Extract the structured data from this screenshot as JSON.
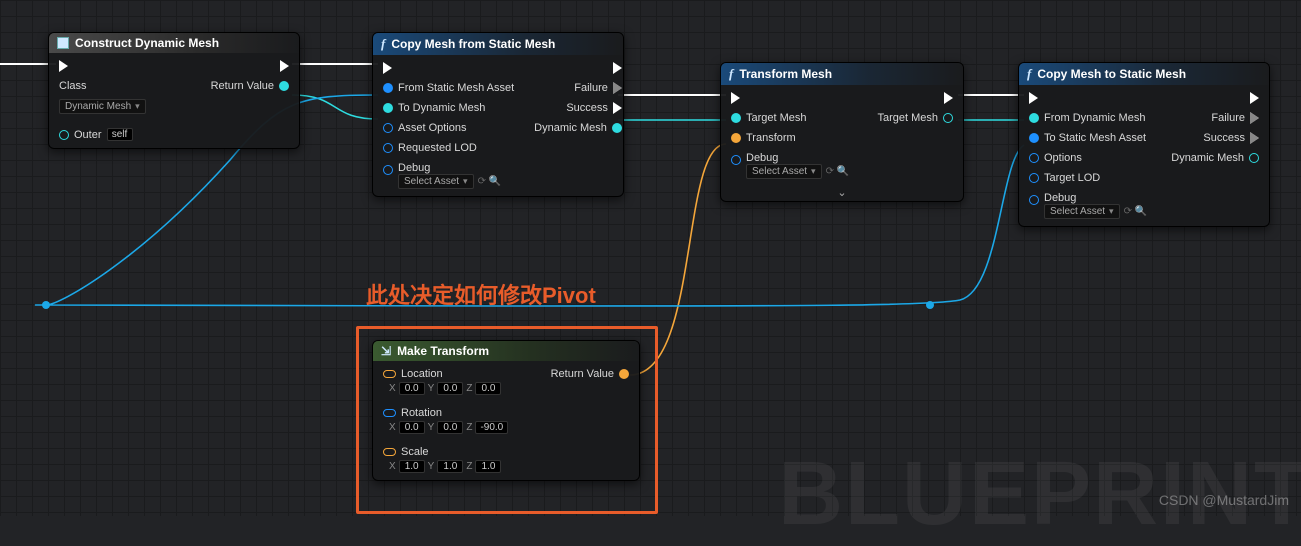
{
  "annotation": "此处决定如何修改Pivot",
  "watermark_bp": "BLUEPRINT",
  "watermark_csdn": "CSDN @MustardJim",
  "nodes": {
    "construct": {
      "title": "Construct Dynamic Mesh",
      "class_label": "Class",
      "class_value": "Dynamic Mesh",
      "outer_label": "Outer",
      "outer_value": "self",
      "return": "Return Value"
    },
    "copyFrom": {
      "title": "Copy Mesh from Static Mesh",
      "failure": "Failure",
      "success": "Success",
      "dynmesh": "Dynamic Mesh",
      "in1": "From Static Mesh Asset",
      "in2": "To Dynamic Mesh",
      "in3": "Asset Options",
      "in4": "Requested LOD",
      "debug": "Debug",
      "debug_value": "Select Asset"
    },
    "transform": {
      "title": "Transform Mesh",
      "targetmesh": "Target Mesh",
      "targetmesh_out": "Target Mesh",
      "transform_in": "Transform",
      "debug": "Debug",
      "debug_value": "Select Asset"
    },
    "copyTo": {
      "title": "Copy Mesh to Static Mesh",
      "failure": "Failure",
      "success": "Success",
      "dynmesh": "Dynamic Mesh",
      "in1": "From Dynamic Mesh",
      "in2": "To Static Mesh Asset",
      "in3": "Options",
      "in4": "Target LOD",
      "debug": "Debug",
      "debug_value": "Select Asset"
    },
    "make": {
      "title": "Make Transform",
      "return": "Return Value",
      "loc": "Location",
      "rot": "Rotation",
      "scale": "Scale",
      "loc_x": "0.0",
      "loc_y": "0.0",
      "loc_z": "0.0",
      "rot_x": "0.0",
      "rot_y": "0.0",
      "rot_z": "-90.0",
      "scl_x": "1.0",
      "scl_y": "1.0",
      "scl_z": "1.0"
    }
  },
  "chart_data": {
    "type": "table",
    "title": "Blueprint Graph",
    "nodes": [
      {
        "id": "construct",
        "label": "Construct Dynamic Mesh",
        "inputs": [
          "exec",
          "Class=Dynamic Mesh",
          "Outer=self"
        ],
        "outputs": [
          "exec",
          "Return Value"
        ]
      },
      {
        "id": "copyFrom",
        "label": "Copy Mesh from Static Mesh",
        "inputs": [
          "exec",
          "From Static Mesh Asset",
          "To Dynamic Mesh",
          "Asset Options",
          "Requested LOD",
          "Debug=Select Asset"
        ],
        "outputs": [
          "exec",
          "Failure",
          "Success",
          "Dynamic Mesh"
        ]
      },
      {
        "id": "transform",
        "label": "Transform Mesh",
        "inputs": [
          "exec",
          "Target Mesh",
          "Transform",
          "Debug=Select Asset"
        ],
        "outputs": [
          "exec",
          "Target Mesh"
        ]
      },
      {
        "id": "copyTo",
        "label": "Copy Mesh to Static Mesh",
        "inputs": [
          "exec",
          "From Dynamic Mesh",
          "To Static Mesh Asset",
          "Options",
          "Target LOD",
          "Debug=Select Asset"
        ],
        "outputs": [
          "exec",
          "Failure",
          "Success",
          "Dynamic Mesh"
        ]
      },
      {
        "id": "make",
        "label": "Make Transform",
        "inputs": [
          "Location=(0.0,0.0,0.0)",
          "Rotation=(0.0,0.0,-90.0)",
          "Scale=(1.0,1.0,1.0)"
        ],
        "outputs": [
          "Return Value"
        ]
      }
    ],
    "edges": [
      {
        "from": "external",
        "to": "construct",
        "kind": "exec"
      },
      {
        "from": "construct",
        "to": "copyFrom",
        "kind": "exec"
      },
      {
        "from": "copyFrom",
        "to": "transform",
        "kind": "exec",
        "branch": "Success"
      },
      {
        "from": "transform",
        "to": "copyTo",
        "kind": "exec"
      },
      {
        "from": "construct.Return Value",
        "to": "copyFrom.To Dynamic Mesh",
        "kind": "data"
      },
      {
        "from": "copyFrom.Dynamic Mesh",
        "to": "transform.Target Mesh",
        "kind": "data"
      },
      {
        "from": "transform.Target Mesh",
        "to": "copyTo.From Dynamic Mesh",
        "kind": "data"
      },
      {
        "from": "make.Return Value",
        "to": "transform.Transform",
        "kind": "data"
      },
      {
        "from": "copyFrom.From Static Mesh Asset",
        "to": "external_loop_left",
        "kind": "data"
      },
      {
        "from": "external_loop_left",
        "to": "copyTo.To Static Mesh Asset",
        "kind": "data"
      }
    ]
  }
}
